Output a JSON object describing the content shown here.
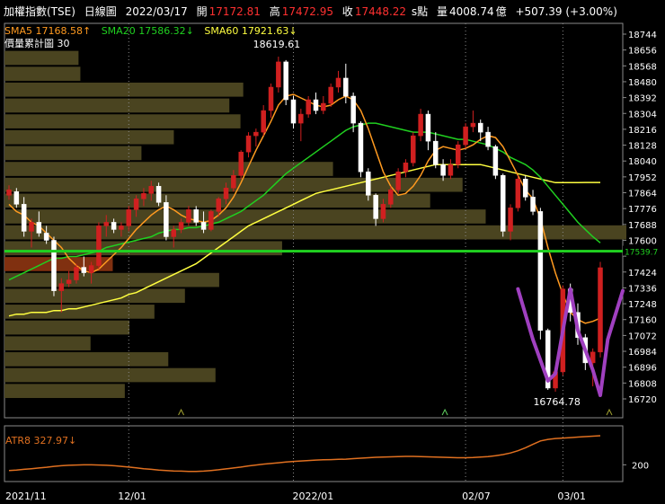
{
  "header": {
    "symbol": "加權指數(TSE)",
    "period": "日線圖",
    "date": "2022/03/17",
    "open_label": "開",
    "open": "17172.81",
    "high_label": "高",
    "high": "17472.95",
    "close_label": "收",
    "close": "17448.22",
    "s_label": "s點",
    "vol_label": "量",
    "volume": "4008.74",
    "vol_unit": "億",
    "change": "+507.39 (+3.00%)"
  },
  "legend": {
    "sma5": "SMA5 17168.58↑",
    "sma20": "SMA20 17586.32↓",
    "sma60": "SMA60 17921.63↓",
    "vp": "價量累計圖 30"
  },
  "colors": {
    "bg": "#000000",
    "up": "#d02020",
    "down": "#ffffff",
    "sma5": "#ff9a20",
    "sma20": "#20d020",
    "sma60": "#ffff40",
    "vp": "#4a4420",
    "vp_hl": "#803010",
    "atr": "#e07020",
    "pattern": "#a040c0",
    "grid": "#8a8a8a",
    "hline": "#20d020"
  },
  "chart_data": {
    "type": "candlestick",
    "y_ticks": [
      18744,
      18656,
      18568,
      18480,
      18392,
      18304,
      18216,
      18128,
      18040,
      17952,
      17864,
      17776,
      17688,
      17600,
      17512,
      17424,
      17336,
      17248,
      17160,
      17072,
      16984,
      16896,
      16808,
      16720
    ],
    "hline_value": 17539.7,
    "hline_label": "17539.7",
    "high_marker": "18619.61",
    "low_marker": "16764.78",
    "x_labels": [
      "2021/11",
      "12/01",
      "2022/01",
      "02/07",
      "03/01"
    ],
    "candles": [
      [
        17850,
        17905,
        17825,
        17880
      ],
      [
        17870,
        17890,
        17780,
        17800
      ],
      [
        17800,
        17840,
        17620,
        17650
      ],
      [
        17650,
        17720,
        17560,
        17700
      ],
      [
        17700,
        17760,
        17620,
        17640
      ],
      [
        17640,
        17680,
        17580,
        17600
      ],
      [
        17600,
        17620,
        17290,
        17320
      ],
      [
        17320,
        17390,
        17200,
        17360
      ],
      [
        17360,
        17430,
        17340,
        17380
      ],
      [
        17380,
        17470,
        17360,
        17450
      ],
      [
        17450,
        17510,
        17400,
        17420
      ],
      [
        17420,
        17480,
        17360,
        17460
      ],
      [
        17460,
        17700,
        17440,
        17680
      ],
      [
        17680,
        17740,
        17620,
        17700
      ],
      [
        17700,
        17720,
        17640,
        17660
      ],
      [
        17660,
        17700,
        17620,
        17680
      ],
      [
        17680,
        17790,
        17650,
        17770
      ],
      [
        17770,
        17850,
        17730,
        17830
      ],
      [
        17830,
        17890,
        17790,
        17860
      ],
      [
        17860,
        17930,
        17820,
        17900
      ],
      [
        17900,
        17920,
        17790,
        17810
      ],
      [
        17810,
        17850,
        17600,
        17620
      ],
      [
        17620,
        17680,
        17560,
        17660
      ],
      [
        17660,
        17720,
        17640,
        17700
      ],
      [
        17700,
        17790,
        17680,
        17770
      ],
      [
        17770,
        17790,
        17680,
        17700
      ],
      [
        17700,
        17760,
        17640,
        17660
      ],
      [
        17660,
        17770,
        17650,
        17760
      ],
      [
        17760,
        17840,
        17730,
        17830
      ],
      [
        17830,
        17920,
        17800,
        17890
      ],
      [
        17890,
        17990,
        17870,
        17960
      ],
      [
        17960,
        18100,
        17940,
        18090
      ],
      [
        18090,
        18200,
        18060,
        18180
      ],
      [
        18180,
        18220,
        18120,
        18200
      ],
      [
        18200,
        18350,
        18180,
        18320
      ],
      [
        18320,
        18470,
        18280,
        18450
      ],
      [
        18450,
        18619,
        18420,
        18590
      ],
      [
        18590,
        18600,
        18350,
        18380
      ],
      [
        18380,
        18400,
        18220,
        18250
      ],
      [
        18250,
        18330,
        18150,
        18300
      ],
      [
        18300,
        18400,
        18280,
        18380
      ],
      [
        18380,
        18420,
        18300,
        18320
      ],
      [
        18320,
        18400,
        18300,
        18360
      ],
      [
        18360,
        18470,
        18340,
        18450
      ],
      [
        18450,
        18540,
        18420,
        18500
      ],
      [
        18500,
        18580,
        18360,
        18400
      ],
      [
        18400,
        18420,
        18200,
        18250
      ],
      [
        18250,
        18260,
        17950,
        17980
      ],
      [
        17980,
        18000,
        17820,
        17850
      ],
      [
        17850,
        17860,
        17680,
        17720
      ],
      [
        17720,
        17830,
        17700,
        17800
      ],
      [
        17800,
        17900,
        17780,
        17880
      ],
      [
        17880,
        18000,
        17860,
        17980
      ],
      [
        17980,
        18050,
        17950,
        18030
      ],
      [
        18030,
        18200,
        18010,
        18180
      ],
      [
        18180,
        18330,
        18150,
        18300
      ],
      [
        18300,
        18320,
        18100,
        18150
      ],
      [
        18150,
        18200,
        18000,
        18020
      ],
      [
        18020,
        18050,
        17930,
        17960
      ],
      [
        17960,
        18050,
        17940,
        18020
      ],
      [
        18020,
        18150,
        18000,
        18130
      ],
      [
        18130,
        18250,
        18110,
        18230
      ],
      [
        18230,
        18320,
        18200,
        18250
      ],
      [
        18250,
        18270,
        18150,
        18200
      ],
      [
        18200,
        18230,
        18100,
        18120
      ],
      [
        18120,
        18130,
        17940,
        17960
      ],
      [
        17960,
        17970,
        17620,
        17650
      ],
      [
        17650,
        17800,
        17600,
        17780
      ],
      [
        17780,
        17960,
        17760,
        17940
      ],
      [
        17940,
        17960,
        17820,
        17840
      ],
      [
        17840,
        17880,
        17740,
        17760
      ],
      [
        17760,
        17780,
        17050,
        17100
      ],
      [
        17100,
        17110,
        16770,
        16780
      ],
      [
        16780,
        16900,
        16760,
        16870
      ],
      [
        16870,
        17350,
        16850,
        17330
      ],
      [
        17330,
        17360,
        17150,
        17200
      ],
      [
        17200,
        17250,
        17020,
        17060
      ],
      [
        17060,
        17080,
        16880,
        16920
      ],
      [
        16920,
        17000,
        16790,
        16980
      ],
      [
        16980,
        17480,
        16950,
        17448
      ]
    ],
    "sma5": [
      17800,
      17760,
      17740,
      17700,
      17680,
      17640,
      17600,
      17560,
      17500,
      17460,
      17430,
      17420,
      17440,
      17480,
      17520,
      17560,
      17610,
      17660,
      17700,
      17740,
      17770,
      17790,
      17770,
      17740,
      17720,
      17710,
      17700,
      17710,
      17740,
      17780,
      17840,
      17920,
      18010,
      18100,
      18180,
      18260,
      18350,
      18400,
      18410,
      18390,
      18370,
      18350,
      18340,
      18350,
      18380,
      18400,
      18380,
      18320,
      18220,
      18100,
      17980,
      17900,
      17850,
      17860,
      17900,
      17960,
      18040,
      18100,
      18120,
      18110,
      18100,
      18110,
      18130,
      18160,
      18180,
      18170,
      18120,
      18040,
      17960,
      17880,
      17830,
      17720,
      17560,
      17420,
      17300,
      17200,
      17160,
      17140,
      17150,
      17168
    ],
    "sma20": [
      17380,
      17400,
      17420,
      17440,
      17460,
      17480,
      17500,
      17500,
      17510,
      17510,
      17520,
      17530,
      17540,
      17560,
      17570,
      17580,
      17590,
      17600,
      17610,
      17620,
      17640,
      17650,
      17660,
      17660,
      17670,
      17670,
      17680,
      17690,
      17700,
      17720,
      17740,
      17760,
      17790,
      17820,
      17850,
      17890,
      17930,
      17970,
      18000,
      18030,
      18060,
      18090,
      18120,
      18150,
      18180,
      18210,
      18230,
      18240,
      18250,
      18250,
      18240,
      18230,
      18220,
      18210,
      18200,
      18200,
      18200,
      18190,
      18180,
      18170,
      18160,
      18160,
      18150,
      18140,
      18130,
      18110,
      18090,
      18060,
      18040,
      18020,
      17990,
      17950,
      17900,
      17850,
      17800,
      17750,
      17700,
      17660,
      17620,
      17586
    ],
    "sma60": [
      17180,
      17190,
      17190,
      17200,
      17200,
      17200,
      17210,
      17210,
      17220,
      17220,
      17230,
      17240,
      17250,
      17260,
      17270,
      17280,
      17300,
      17310,
      17330,
      17350,
      17370,
      17390,
      17410,
      17430,
      17450,
      17470,
      17500,
      17530,
      17560,
      17590,
      17620,
      17650,
      17680,
      17700,
      17720,
      17740,
      17760,
      17780,
      17800,
      17820,
      17840,
      17860,
      17870,
      17880,
      17890,
      17900,
      17910,
      17920,
      17930,
      17940,
      17950,
      17960,
      17970,
      17980,
      17990,
      18000,
      18010,
      18020,
      18020,
      18020,
      18020,
      18020,
      18020,
      18020,
      18010,
      18000,
      17990,
      17980,
      17970,
      17960,
      17950,
      17940,
      17930,
      17920,
      17920,
      17920,
      17920,
      17921,
      17921,
      17921
    ],
    "price_volume": [
      [
        18744,
        18656,
        0
      ],
      [
        18656,
        18568,
        80
      ],
      [
        18568,
        18480,
        82
      ],
      [
        18480,
        18392,
        258
      ],
      [
        18392,
        18304,
        243
      ],
      [
        18304,
        18216,
        255
      ],
      [
        18216,
        18128,
        183
      ],
      [
        18128,
        18040,
        148
      ],
      [
        18040,
        17952,
        355
      ],
      [
        17952,
        17864,
        495
      ],
      [
        17864,
        17776,
        460
      ],
      [
        17776,
        17688,
        520
      ],
      [
        17688,
        17600,
        672
      ],
      [
        17600,
        17512,
        300
      ],
      [
        17512,
        17424,
        117
      ],
      [
        17424,
        17336,
        232
      ],
      [
        17336,
        17248,
        195
      ],
      [
        17248,
        17160,
        162
      ],
      [
        17160,
        17072,
        135
      ],
      [
        17072,
        16984,
        93
      ],
      [
        16984,
        16896,
        177
      ],
      [
        16896,
        16808,
        228
      ],
      [
        16808,
        16720,
        130
      ]
    ],
    "vp_highlight_index": 14,
    "atr_label": "ATR8 327.97↓",
    "atr_tick": "200",
    "atr": [
      175,
      177,
      180,
      183,
      186,
      189,
      193,
      196,
      198,
      199,
      200,
      200,
      199,
      198,
      196,
      193,
      190,
      187,
      183,
      180,
      177,
      175,
      173,
      172,
      171,
      171,
      172,
      175,
      178,
      182,
      186,
      190,
      195,
      199,
      203,
      206,
      209,
      212,
      215,
      217,
      219,
      221,
      222,
      223,
      224,
      225,
      227,
      229,
      231,
      233,
      234,
      235,
      236,
      237,
      237,
      236,
      235,
      234,
      233,
      232,
      231,
      231,
      232,
      234,
      236,
      240,
      245,
      252,
      262,
      275,
      290,
      305,
      312,
      316,
      318,
      320,
      322,
      324,
      326,
      328
    ]
  }
}
